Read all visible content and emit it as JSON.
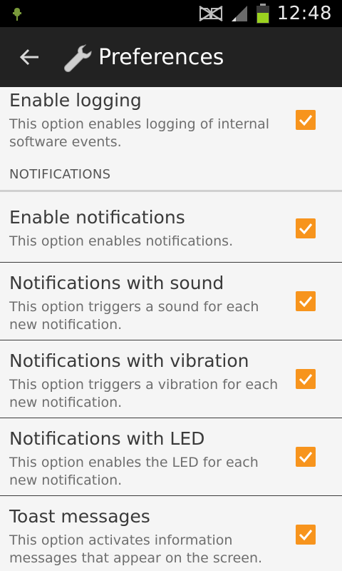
{
  "status_bar": {
    "time": "12:48",
    "icons": [
      "usb-debug-icon",
      "no-sim-icon",
      "signal-icon",
      "battery-icon"
    ],
    "battery_color": "#9bd21f"
  },
  "action_bar": {
    "title": "Preferences",
    "icons": [
      "back-arrow-icon",
      "wrench-icon"
    ]
  },
  "accent_color": "#f7941d",
  "preferences": [
    {
      "title": "Enable logging",
      "summary": "This option enables logging of internal software events.",
      "checked": true
    }
  ],
  "category": {
    "label": "NOTIFICATIONS"
  },
  "notification_prefs": [
    {
      "title": "Enable notifications",
      "summary": "This option enables notifications.",
      "checked": true
    },
    {
      "title": "Notifications with sound",
      "summary": "This option triggers a sound for each new notification.",
      "checked": true
    },
    {
      "title": "Notifications with vibration",
      "summary": "This option triggers a vibration for each new notification.",
      "checked": true
    },
    {
      "title": "Notifications with LED",
      "summary": "This option enables the LED for each new notification.",
      "checked": true
    },
    {
      "title": "Toast messages",
      "summary": "This option activates information messages that appear on the screen.",
      "checked": true
    }
  ]
}
